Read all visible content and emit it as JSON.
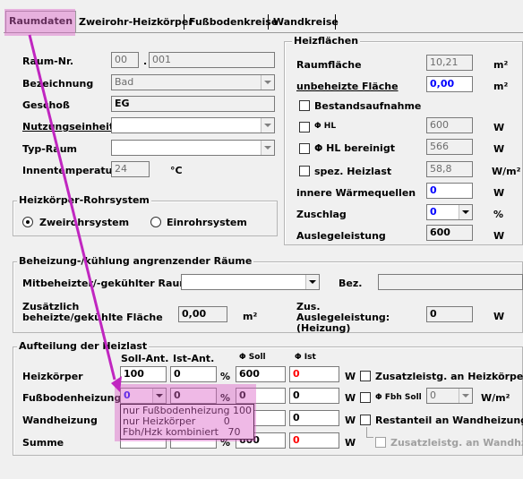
{
  "tabs": [
    "Raumdaten",
    "Zweirohr-Heizkörper",
    "Fußbodenkreise",
    "Wandkreise"
  ],
  "room": {
    "raum_nr_label": "Raum-Nr.",
    "raum_nr_a": "00",
    "raum_nr_sep": ".",
    "raum_nr_b": "001",
    "bezeichnung_label": "Bezeichnung",
    "bezeichnung": "Bad",
    "geschoss_label": "Geschoß",
    "geschoss": "EG",
    "nutzung_label": "Nutzungseinheit",
    "nutzung": "",
    "typ_label": "Typ-Raum",
    "typ": "",
    "temp_label": "Innentemperatur",
    "temp": "24",
    "temp_unit": "°C"
  },
  "heizflaechen": {
    "title": "Heizflächen",
    "raumflaeche_label": "Raumfläche",
    "raumflaeche": "10,21",
    "raumflaeche_unit": "m²",
    "unbeheizt_label": "unbeheizte Fläche",
    "unbeheizt": "0,00",
    "unbeheizt_unit": "m²",
    "bestand_label": "Bestandsaufnahme",
    "phi_hl_label": "Φ HL",
    "phi_hl": "600",
    "phi_hl_unit": "W",
    "phi_hl_ber_label": "Φ HL  bereinigt",
    "phi_hl_ber": "566",
    "phi_hl_ber_unit": "W",
    "spez_label": "spez. Heizlast",
    "spez": "58,8",
    "spez_unit": "W/m²",
    "innere_label": "innere Wärmequellen",
    "innere": "0",
    "innere_unit": "W",
    "zuschlag_label": "Zuschlag",
    "zuschlag": "0",
    "zuschlag_unit": "%",
    "ausleg_label": "Auslegeleistung",
    "ausleg": "600",
    "ausleg_unit": "W"
  },
  "rohrsystem": {
    "title": "Heizkörper-Rohrsystem",
    "opt1": "Zweirohrsystem",
    "opt2": "Einrohrsystem"
  },
  "beheizung": {
    "title": "Beheizung-/kühlung angrenzender Räume",
    "mitbeheizt_label": "Mitbeheizter/-gekühlter Raum",
    "mitbeheizt": "",
    "bez_label": "Bez.",
    "bez": "",
    "zus_flaeche_label": "Zusätzlich beheizte/gekühlte Fläche",
    "zus_flaeche": "0,00",
    "zus_flaeche_unit": "m²",
    "zus_ausleg_label": "Zus. Auslegeleistung: (Heizung)",
    "zus_ausleg": "0",
    "zus_ausleg_unit": "W"
  },
  "aufteilung": {
    "title": "Aufteilung der Heizlast",
    "col_soll": "Soll-Ant.",
    "col_ist": "Ist-Ant.",
    "col_phi_soll": "Φ Soll",
    "col_phi_ist": "Φ Ist",
    "rows": [
      {
        "label": "Heizkörper",
        "soll": "100",
        "ist": "0",
        "pct": "%",
        "phi_soll": "600",
        "phi_ist": "0",
        "w": "W",
        "extra": "Zusatzleistg. an Heizkörper"
      },
      {
        "label": "Fußbodenheizung",
        "soll": "0",
        "ist": "0",
        "pct": "%",
        "phi_soll": "0",
        "phi_ist": "0",
        "w": "W",
        "extra": "Φ Fbh Soll",
        "extra_val": "0",
        "extra_unit": "W/m²"
      },
      {
        "label": "Wandheizung",
        "soll": "",
        "ist": "",
        "pct": "",
        "phi_soll": "",
        "phi_ist": "0",
        "w": "W",
        "extra": "Restanteil an Wandheizung"
      },
      {
        "label": "Summe",
        "soll": "",
        "ist": "",
        "pct": "%",
        "phi_soll": "600",
        "phi_ist": "0",
        "w": "W",
        "extra": "Zusatzleistg. an Wandhzg."
      }
    ],
    "popup": [
      "nur Fußbodenheizung 100",
      "nur Heizkörper         0",
      "Fbh/Hzk kombiniert   70"
    ]
  },
  "colors": {
    "highlight": "#dc64c8",
    "arrow": "#c026c0",
    "blue_value": "#0000ff",
    "red_value": "#ff0000"
  }
}
